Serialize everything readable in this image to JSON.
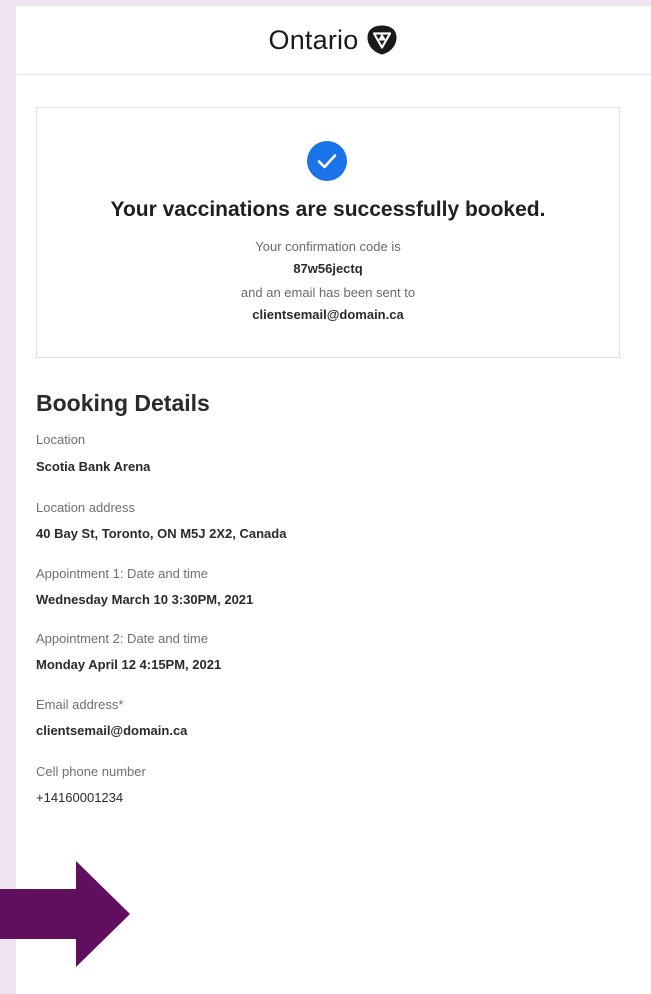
{
  "header": {
    "brand": "Ontario",
    "logo_icon": "ontario-trillium-logo"
  },
  "confirmation": {
    "icon": "check-circle-icon",
    "title": "Your vaccinations are successfully booked.",
    "code_intro": "Your confirmation code is",
    "code": "87w56jectq",
    "email_intro": "and an email has been sent to",
    "email": "clientsemail@domain.ca"
  },
  "booking_details": {
    "title": "Booking Details",
    "fields": [
      {
        "label": "Location",
        "value": "Scotia Bank Arena"
      },
      {
        "label": "Location address",
        "value": "40 Bay St, Toronto, ON M5J 2X2, Canada"
      },
      {
        "label": "Appointment 1: Date and time",
        "value": "Wednesday March 10 3:30PM, 2021"
      },
      {
        "label": "Appointment 2: Date and time",
        "value": "Monday April 12 4:15PM, 2021"
      },
      {
        "label": "Email address*",
        "value": "clientsemail@domain.ca"
      },
      {
        "label": "Cell phone number",
        "value": "+14160001234"
      }
    ]
  },
  "colors": {
    "accent_blue": "#1a73e8",
    "arrow_purple": "#5f0f5e",
    "background_lavender": "#efe3f0"
  },
  "decor": {
    "arrow_icon": "right-arrow-icon"
  }
}
